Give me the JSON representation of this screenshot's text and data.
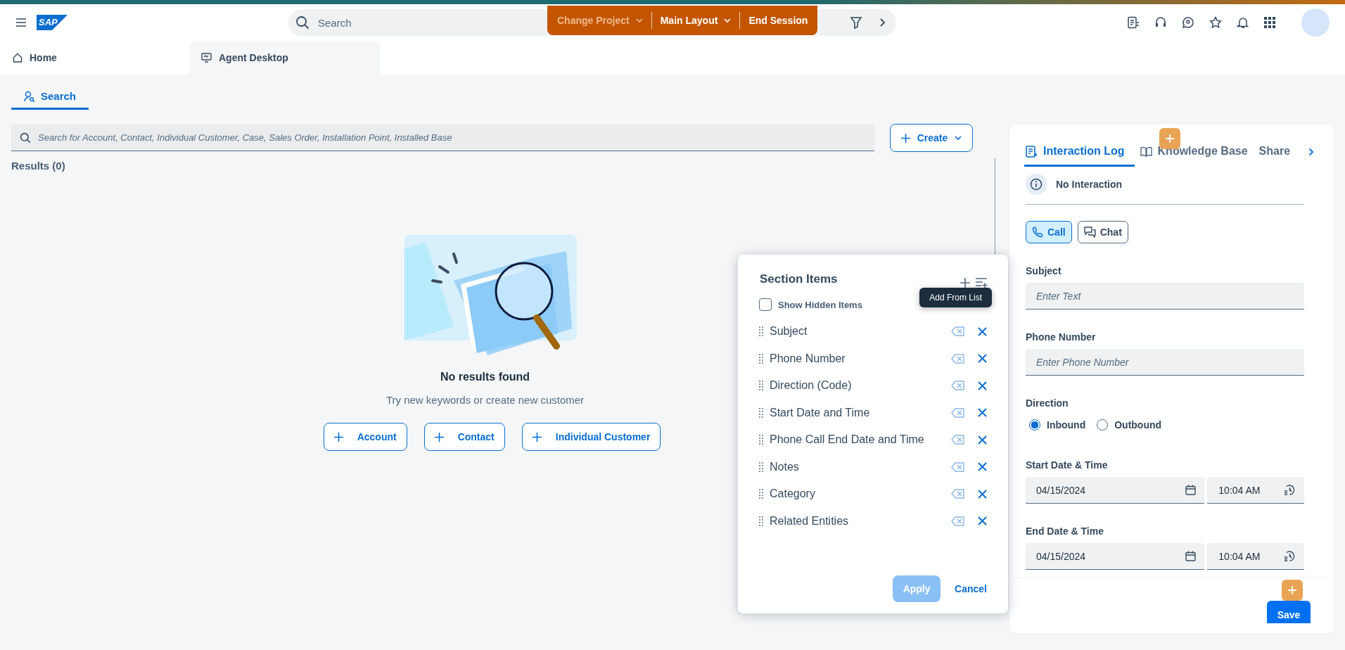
{
  "shell": {
    "logo": "SAP",
    "search_placeholder": "Search",
    "session_bar": [
      {
        "label": "Change Project",
        "dropdown": true,
        "disabled": true
      },
      {
        "label": "Main Layout",
        "dropdown": true,
        "disabled": false
      },
      {
        "label": "End Session",
        "dropdown": false,
        "disabled": false
      }
    ]
  },
  "nav_tabs": [
    {
      "label": "Home",
      "selected": false
    },
    {
      "label": "Agent Desktop",
      "selected": true
    }
  ],
  "search_tabs": [
    {
      "label": "Search",
      "selected": true
    }
  ],
  "search": {
    "placeholder": "Search for Account, Contact, Individual Customer, Case, Sales Order, Installation Point, Installed Base",
    "create_label": "Create",
    "results": "Results (0)"
  },
  "empty_state": {
    "title": "No results found",
    "message": "Try new keywords or create new customer",
    "buttons": [
      "Account",
      "Contact",
      "Individual Customer"
    ]
  },
  "section_items_dialog": {
    "title": "Section Items",
    "tooltip": "Add From List",
    "show_hidden": {
      "label": "Show Hidden Items",
      "checked": false
    },
    "items": [
      "Subject",
      "Phone Number",
      "Direction (Code)",
      "Start Date and Time",
      "Phone Call End Date and Time",
      "Notes",
      "Category",
      "Related Entities"
    ],
    "apply": {
      "label": "Apply",
      "disabled": true
    },
    "cancel": "Cancel"
  },
  "interaction_panel": {
    "tabs": [
      {
        "label": "Interaction Log",
        "selected": true
      },
      {
        "label": "Knowledge Base",
        "selected": false
      },
      {
        "label": "Share",
        "selected": false
      }
    ],
    "status": "No Interaction",
    "channels": [
      {
        "label": "Call",
        "selected": true
      },
      {
        "label": "Chat",
        "selected": false
      }
    ],
    "fields": [
      {
        "kind": "text",
        "label": "Subject",
        "placeholder": "Enter Text"
      },
      {
        "kind": "text",
        "label": "Phone Number",
        "placeholder": "Enter Phone Number"
      },
      {
        "kind": "radio",
        "label": "Direction",
        "options": [
          {
            "label": "Inbound",
            "selected": true
          },
          {
            "label": "Outbound",
            "selected": false
          }
        ]
      },
      {
        "kind": "datetime",
        "label": "Start Date & Time",
        "date": "04/15/2024",
        "time": "10:04 AM"
      },
      {
        "kind": "datetime",
        "label": "End Date & Time",
        "date": "04/15/2024",
        "time": "10:04 AM"
      }
    ],
    "save": "Save"
  }
}
